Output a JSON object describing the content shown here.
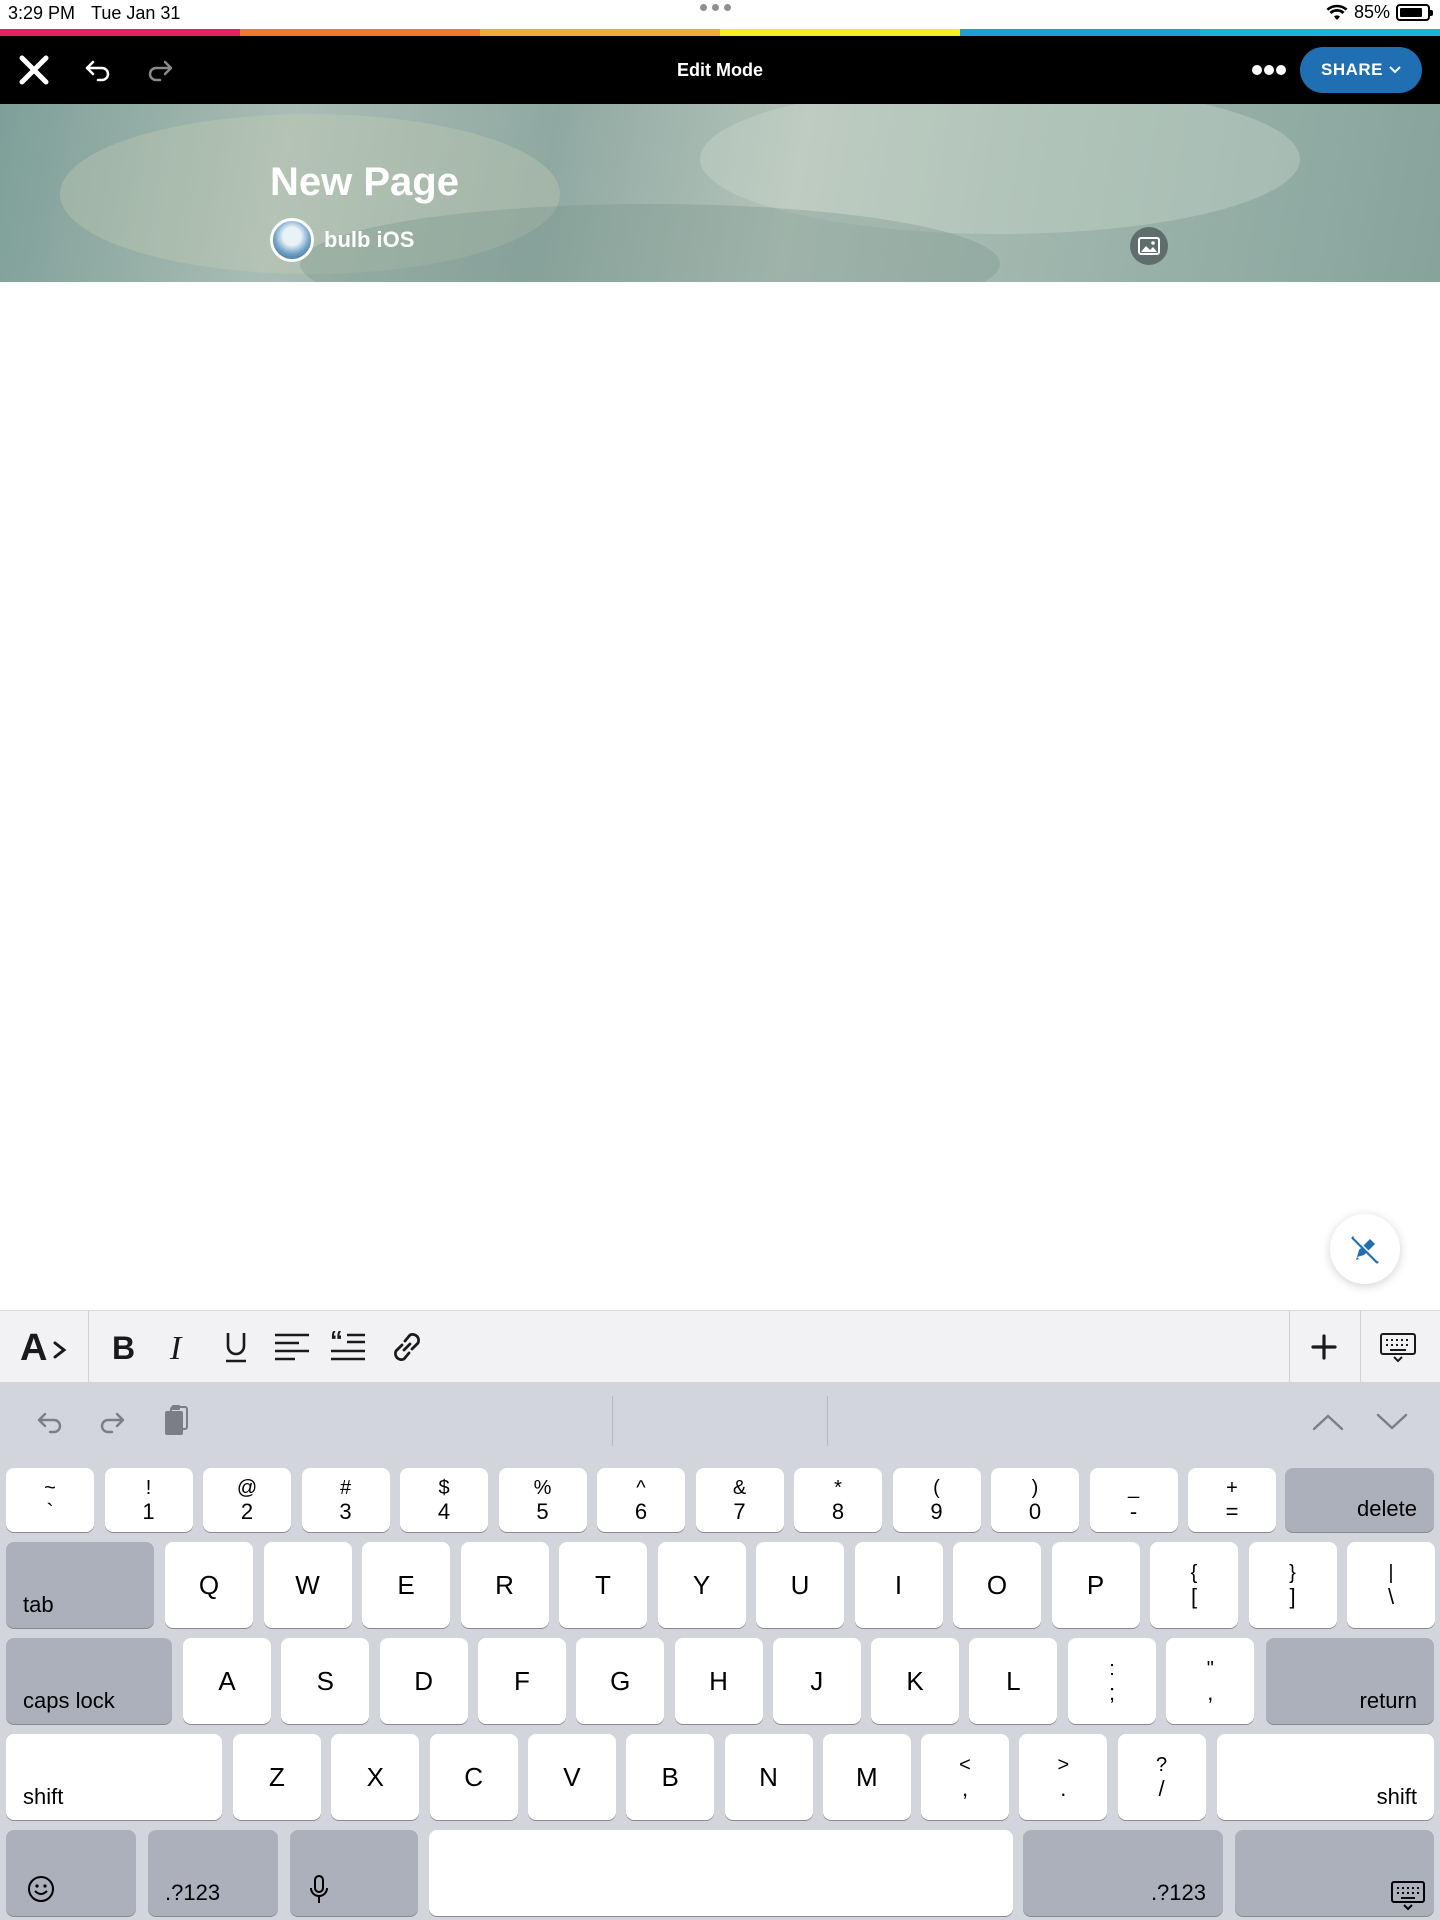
{
  "status_bar": {
    "time": "3:29 PM",
    "date": "Tue Jan 31",
    "battery": "85%",
    "battery_level": 0.85
  },
  "rainbow_colors": [
    "#e0245e",
    "#f2792b",
    "#f4a93b",
    "#f7ef1e",
    "#1e9fd8",
    "#1cb0dc"
  ],
  "nav": {
    "title": "Edit Mode",
    "share_label": "SHARE",
    "accent": "#1f6fb2"
  },
  "page": {
    "title": "New Page",
    "author": "bulb iOS"
  },
  "keyboard": {
    "row_numbers": [
      {
        "top": "~",
        "bottom": "`"
      },
      {
        "top": "!",
        "bottom": "1"
      },
      {
        "top": "@",
        "bottom": "2"
      },
      {
        "top": "#",
        "bottom": "3"
      },
      {
        "top": "$",
        "bottom": "4"
      },
      {
        "top": "%",
        "bottom": "5"
      },
      {
        "top": "^",
        "bottom": "6"
      },
      {
        "top": "&",
        "bottom": "7"
      },
      {
        "top": "*",
        "bottom": "8"
      },
      {
        "top": "(",
        "bottom": "9"
      },
      {
        "top": ")",
        "bottom": "0"
      },
      {
        "top": "_",
        "bottom": "-"
      },
      {
        "top": "+",
        "bottom": "="
      }
    ],
    "delete": "delete",
    "tab": "tab",
    "row_q": [
      "Q",
      "W",
      "E",
      "R",
      "T",
      "Y",
      "U",
      "I",
      "O",
      "P"
    ],
    "row_q_extra": [
      {
        "top": "{",
        "bottom": "["
      },
      {
        "top": "}",
        "bottom": "]"
      },
      {
        "top": "|",
        "bottom": "\\"
      }
    ],
    "caps_lock": "caps lock",
    "row_a": [
      "A",
      "S",
      "D",
      "F",
      "G",
      "H",
      "J",
      "K",
      "L"
    ],
    "row_a_extra": [
      {
        "top": ":",
        "bottom": ";"
      },
      {
        "top": "\"",
        "bottom": ","
      }
    ],
    "return": "return",
    "shift": "shift",
    "row_z": [
      "Z",
      "X",
      "C",
      "V",
      "B",
      "N",
      "M"
    ],
    "row_z_extra": [
      {
        "top": "<",
        "bottom": ","
      },
      {
        "top": ">",
        "bottom": "."
      },
      {
        "top": "?",
        "bottom": "/"
      }
    ],
    "num_toggle": ".?123"
  }
}
